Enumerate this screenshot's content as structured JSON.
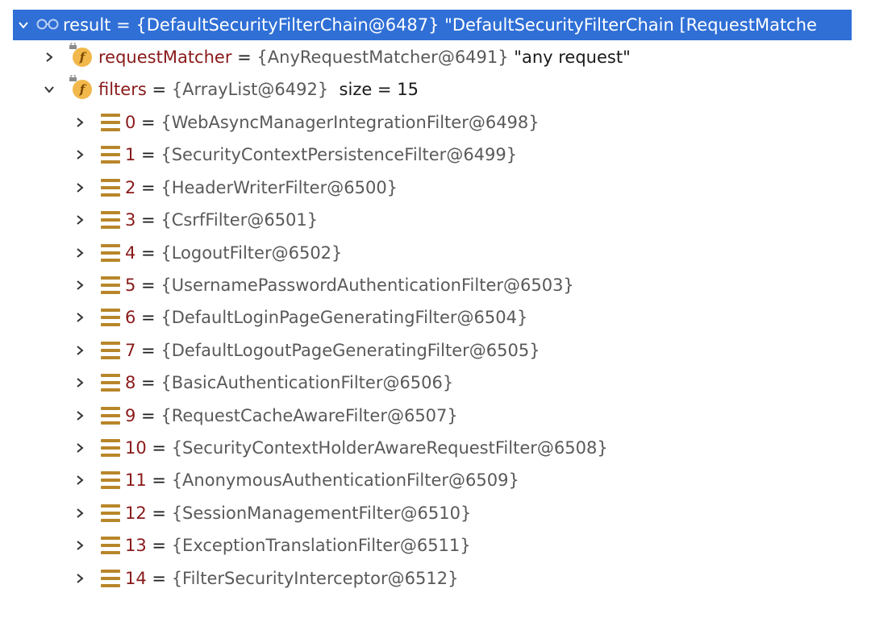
{
  "root": {
    "name": "result",
    "eq": " = ",
    "value": "{DefaultSecurityFilterChain@6487} \"DefaultSecurityFilterChain [RequestMatche"
  },
  "requestMatcher": {
    "name": "requestMatcher",
    "eq": " = ",
    "value": "{AnyRequestMatcher@6491}",
    "extra": " \"any request\""
  },
  "filters": {
    "name": "filters",
    "eq": " = ",
    "value": "{ArrayList@6492}",
    "extra": "  size = 15"
  },
  "items": [
    {
      "index": "0",
      "eq": " = ",
      "value": "{WebAsyncManagerIntegrationFilter@6498}"
    },
    {
      "index": "1",
      "eq": " = ",
      "value": "{SecurityContextPersistenceFilter@6499}"
    },
    {
      "index": "2",
      "eq": " = ",
      "value": "{HeaderWriterFilter@6500}"
    },
    {
      "index": "3",
      "eq": " = ",
      "value": "{CsrfFilter@6501}"
    },
    {
      "index": "4",
      "eq": " = ",
      "value": "{LogoutFilter@6502}"
    },
    {
      "index": "5",
      "eq": " = ",
      "value": "{UsernamePasswordAuthenticationFilter@6503}"
    },
    {
      "index": "6",
      "eq": " = ",
      "value": "{DefaultLoginPageGeneratingFilter@6504}"
    },
    {
      "index": "7",
      "eq": " = ",
      "value": "{DefaultLogoutPageGeneratingFilter@6505}"
    },
    {
      "index": "8",
      "eq": " = ",
      "value": "{BasicAuthenticationFilter@6506}"
    },
    {
      "index": "9",
      "eq": " = ",
      "value": "{RequestCacheAwareFilter@6507}"
    },
    {
      "index": "10",
      "eq": " = ",
      "value": "{SecurityContextHolderAwareRequestFilter@6508}"
    },
    {
      "index": "11",
      "eq": " = ",
      "value": "{AnonymousAuthenticationFilter@6509}"
    },
    {
      "index": "12",
      "eq": " = ",
      "value": "{SessionManagementFilter@6510}"
    },
    {
      "index": "13",
      "eq": " = ",
      "value": "{ExceptionTranslationFilter@6511}"
    },
    {
      "index": "14",
      "eq": " = ",
      "value": "{FilterSecurityInterceptor@6512}"
    }
  ],
  "icons": {
    "expand": "chevron-down-icon",
    "collapse": "chevron-right-icon",
    "field": "field-f-icon",
    "element": "list-element-icon",
    "watch": "watch-glasses-icon"
  },
  "colors": {
    "selection": "#2f6fd6",
    "index": "#8a1a1a",
    "value": "#595959",
    "field_badge": "#f2b84b",
    "element_icon": "#b8862a"
  }
}
